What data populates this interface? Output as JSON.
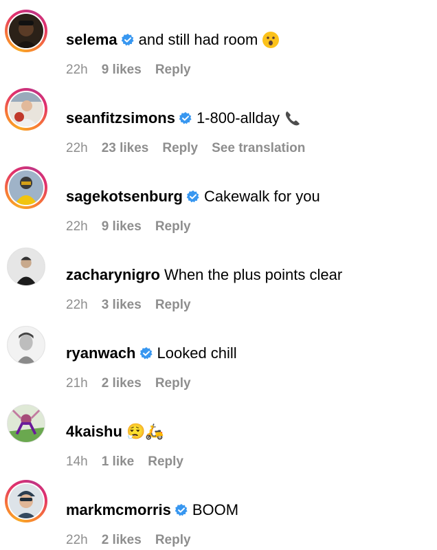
{
  "comments": [
    {
      "username": "selema",
      "verified": true,
      "text": "and still had room",
      "emoji": "😮",
      "time": "22h",
      "likes": "9 likes",
      "reply": "Reply",
      "story_ring": true,
      "avatar_color": "#3a2a1a"
    },
    {
      "username": "seanfitzsimons",
      "verified": true,
      "text": "1-800-allday",
      "emoji": "📞",
      "time": "22h",
      "likes": "23 likes",
      "reply": "Reply",
      "see_translation": "See translation",
      "story_ring": true,
      "avatar_color": "#b84a3c"
    },
    {
      "username": "sagekotsenburg",
      "verified": true,
      "text": "Cakewalk for you",
      "time": "22h",
      "likes": "9 likes",
      "reply": "Reply",
      "story_ring": true,
      "avatar_color": "#e2b400"
    },
    {
      "username": "zacharynigro",
      "verified": false,
      "text": "When the plus points clear",
      "time": "22h",
      "likes": "3 likes",
      "reply": "Reply",
      "story_ring": false,
      "avatar_color": "#d9d9d9"
    },
    {
      "username": "ryanwach",
      "verified": true,
      "text": "Looked chill",
      "time": "21h",
      "likes": "2 likes",
      "reply": "Reply",
      "story_ring": false,
      "avatar_color": "#e8e8e8"
    },
    {
      "username": "4kaishu",
      "verified": false,
      "text": "😮‍💨🛵",
      "time": "14h",
      "likes": "1 like",
      "reply": "Reply",
      "story_ring": false,
      "avatar_color": "#6aa84f"
    },
    {
      "username": "markmcmorris",
      "verified": true,
      "text": "BOOM",
      "time": "22h",
      "likes": "2 likes",
      "reply": "Reply",
      "story_ring": true,
      "avatar_color": "#cfd6dd"
    }
  ],
  "colors": {
    "verified_blue": "#3897f0",
    "meta_gray": "#8e8e8e"
  },
  "icons": {
    "verified": "verified-badge-icon",
    "surprised": "surprised-face-emoji",
    "telephone": "telephone-receiver-emoji"
  }
}
